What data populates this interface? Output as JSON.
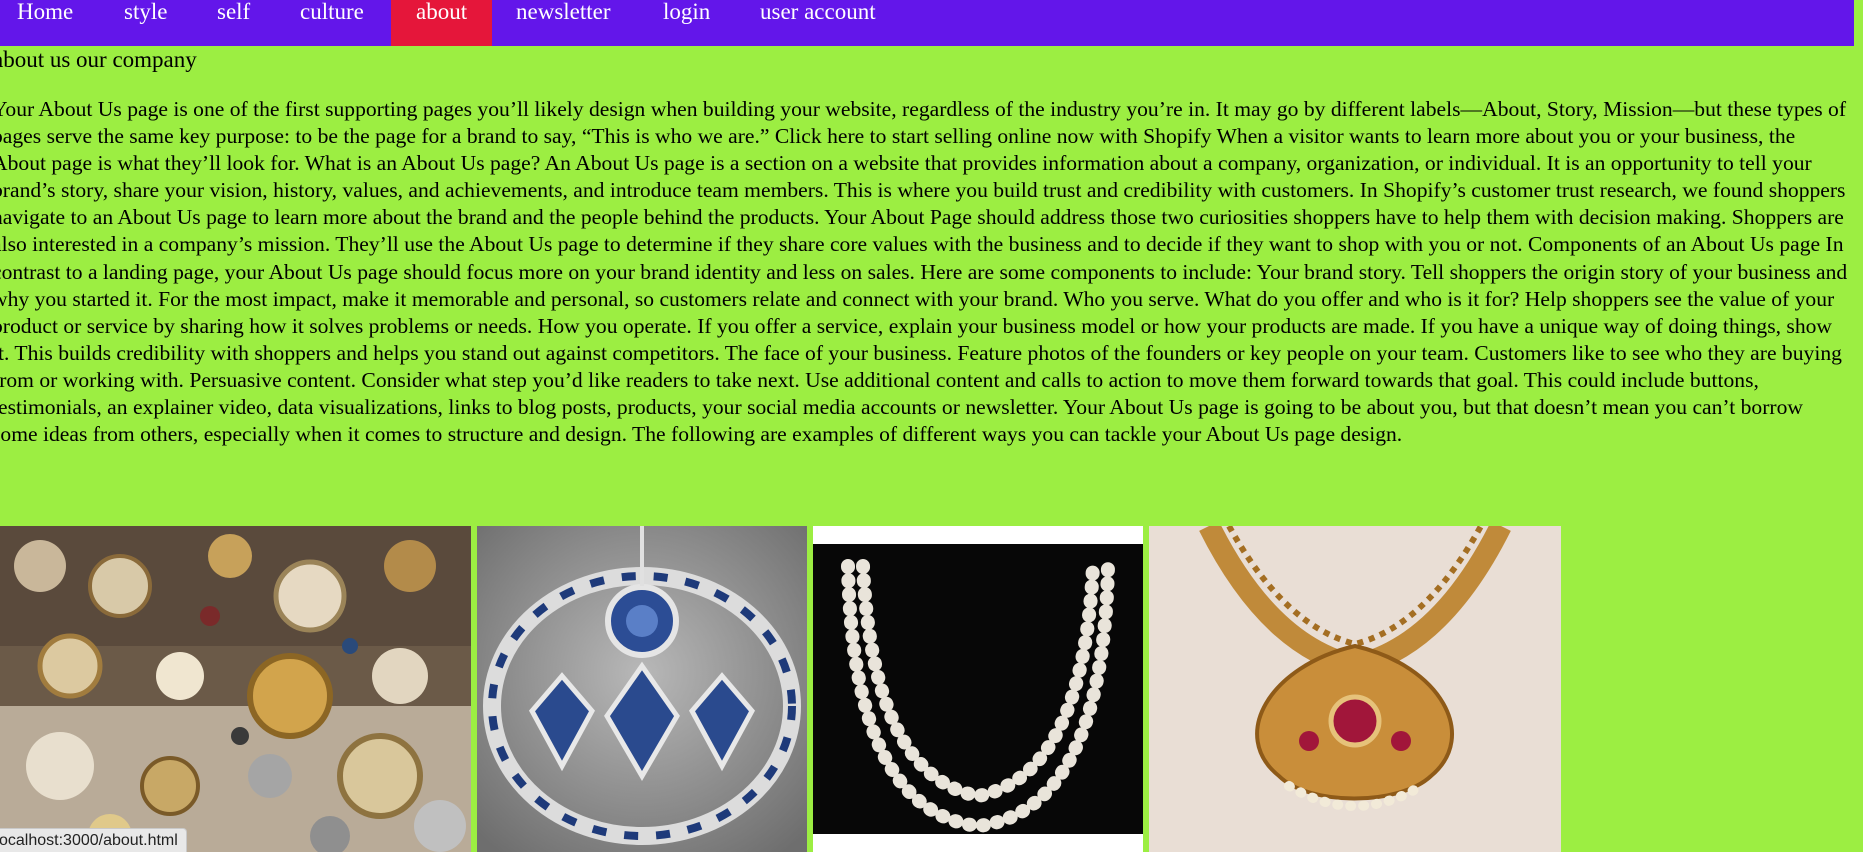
{
  "nav": {
    "items": [
      {
        "label": "Home"
      },
      {
        "label": "style"
      },
      {
        "label": "self"
      },
      {
        "label": "culture"
      },
      {
        "label": "about",
        "active": true
      },
      {
        "label": "newsletter"
      },
      {
        "label": "login"
      },
      {
        "label": "user account"
      }
    ]
  },
  "main": {
    "heading": "about us our company",
    "paragraph": "Your About Us page is one of the first supporting pages you’ll likely design when building your website, regardless of the industry you’re in. It may go by different labels—About, Story, Mission—but these types of pages serve the same key purpose: to be the page for a brand to say, “This is who we are.” Click here to start selling online now with Shopify When a visitor wants to learn more about you or your business, the About page is what they’ll look for. What is an About Us page? An About Us page is a section on a website that provides information about a company, organization, or individual. It is an opportunity to tell your brand’s story, share your vision, history, values, and achievements, and introduce team members. This is where you build trust and credibility with customers. In Shopify’s customer trust research, we found shoppers navigate to an About Us page to learn more about the brand and the people behind the products. Your About Page should address those two curiosities shoppers have to help them with decision making. Shoppers are also interested in a company’s mission. They’ll use the About Us page to determine if they share core values with the business and to decide if they want to shop with you or not. Components of an About Us page In contrast to a landing page, your About Us page should focus more on your brand identity and less on sales. Here are some components to include: Your brand story. Tell shoppers the origin story of your business and why you started it. For the most impact, make it memorable and personal, so customers relate and connect with your brand. Who you serve. What do you offer and who is it for? Help shoppers see the value of your product or service by sharing how it solves problems or needs. How you operate. If you offer a service, explain your business model or how your products are made. If you have a unique way of doing things, show it. This builds credibility with shoppers and helps you stand out against competitors. The face of your business. Feature photos of the founders or key people on your team. Customers like to see who they are buying from or working with. Persuasive content. Consider what step you’d like readers to take next. Use additional content and calls to action to move them forward towards that goal. This could include buttons, testimonials, an explainer video, data visualizations, links to blog posts, products, your social media accounts or newsletter. Your About Us page is going to be about you, but that doesn’t mean you can’t borrow some ideas from others, especially when it comes to structure and design. The following are examples of different ways you can tackle your About Us page design."
  },
  "gallery": {
    "images": [
      {
        "icon": "assorted-jewelry-image"
      },
      {
        "icon": "sapphire-jewelry-set-image"
      },
      {
        "icon": "pearl-necklace-image"
      },
      {
        "icon": "gold-necklace-image"
      }
    ]
  },
  "status_bar": {
    "url": "ocalhost:3000/about.html"
  },
  "colors": {
    "page_background": "#9cee42",
    "nav_background": "#6316ea",
    "nav_active": "#e5163a",
    "nav_text": "#ffffff"
  }
}
